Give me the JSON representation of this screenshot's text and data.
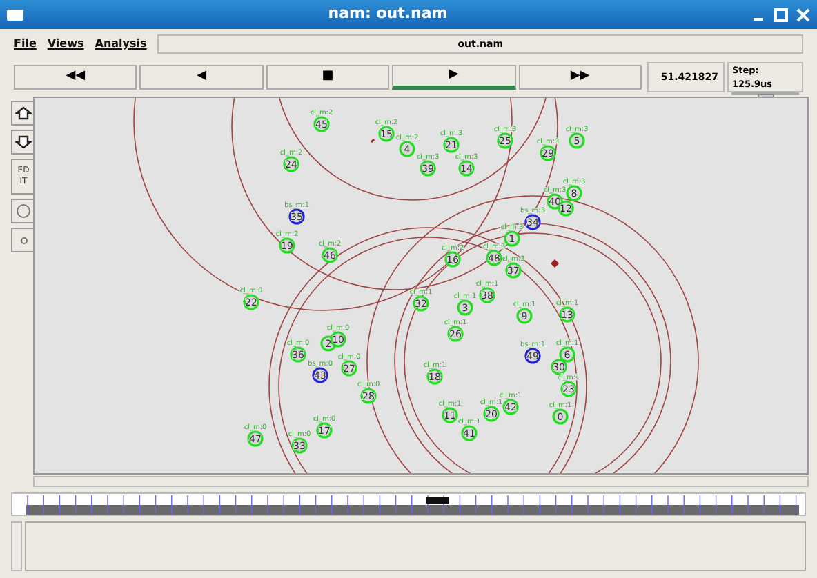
{
  "window": {
    "title": "nam: out.nam"
  },
  "menu": [
    {
      "label": "File"
    },
    {
      "label": "Views"
    },
    {
      "label": "Analysis"
    }
  ],
  "file_field": {
    "value": "out.nam"
  },
  "transport": [
    {
      "glyph": "◀◀",
      "selected": false
    },
    {
      "glyph": "◀",
      "selected": false
    },
    {
      "glyph": "■",
      "selected": false
    },
    {
      "glyph": "▶",
      "selected": true
    },
    {
      "glyph": "▶▶",
      "selected": false
    }
  ],
  "time": "51.421827",
  "step": {
    "label": "Step: 125.9us",
    "level": 0.5
  },
  "tools": [
    {
      "kind": "zoom-in"
    },
    {
      "kind": "zoom-out"
    },
    {
      "kind": "edit",
      "label": "EDIT"
    },
    {
      "kind": "circle"
    },
    {
      "kind": "dot"
    }
  ],
  "nodes": [
    {
      "id": "45",
      "label": "cl_m:2",
      "kind": "mobile"
    },
    {
      "id": "15",
      "label": "cl_m:2",
      "kind": "mobile"
    },
    {
      "id": "4",
      "label": "cl_m:2",
      "kind": "mobile"
    },
    {
      "id": "21",
      "label": "cl_m:3",
      "kind": "mobile"
    },
    {
      "id": "25",
      "label": "cl_m:3",
      "kind": "mobile"
    },
    {
      "id": "29",
      "label": "cl_m:3",
      "kind": "mobile"
    },
    {
      "id": "5",
      "label": "cl_m:3",
      "kind": "mobile"
    },
    {
      "id": "24",
      "label": "cl_m:2",
      "kind": "mobile"
    },
    {
      "id": "39",
      "label": "cl_m:3",
      "kind": "mobile"
    },
    {
      "id": "14",
      "label": "cl_m:3",
      "kind": "mobile"
    },
    {
      "id": "8",
      "label": "cl_m:3",
      "kind": "mobile"
    },
    {
      "id": "40",
      "label": "cl_m:3",
      "kind": "mobile"
    },
    {
      "id": "35",
      "label": "bs_m:1",
      "kind": "base"
    },
    {
      "id": "34",
      "label": "bs_m:3",
      "kind": "base"
    },
    {
      "id": "12",
      "kind": "mobile"
    },
    {
      "id": "1",
      "label": "cl_m:3",
      "kind": "mobile"
    },
    {
      "id": "19",
      "label": "cl_m:2",
      "kind": "mobile"
    },
    {
      "id": "46",
      "label": "cl_m:2",
      "kind": "mobile"
    },
    {
      "id": "16",
      "label": "cl_m:2",
      "kind": "mobile"
    },
    {
      "id": "48",
      "label": "cl_m:3",
      "kind": "mobile"
    },
    {
      "id": "37",
      "label": "cl_m:3",
      "kind": "mobile"
    },
    {
      "id": "22",
      "label": "cl_m:0",
      "kind": "mobile"
    },
    {
      "id": "32",
      "label": "cl_m:1",
      "kind": "mobile"
    },
    {
      "id": "3",
      "label": "cl_m:1",
      "kind": "mobile"
    },
    {
      "id": "38",
      "label": "cl_m:1",
      "kind": "mobile"
    },
    {
      "id": "9",
      "label": "cl_m:1",
      "kind": "mobile"
    },
    {
      "id": "13",
      "label": "cl_m:1",
      "kind": "mobile"
    },
    {
      "id": "26",
      "label": "cl_m:1",
      "kind": "mobile"
    },
    {
      "id": "2",
      "kind": "mobile"
    },
    {
      "id": "10",
      "label": "cl_m:0",
      "kind": "mobile"
    },
    {
      "id": "36",
      "label": "cl_m:0",
      "kind": "mobile"
    },
    {
      "id": "43",
      "label": "bs_m:0",
      "kind": "base"
    },
    {
      "id": "27",
      "label": "cl_m:0",
      "kind": "mobile"
    },
    {
      "id": "18",
      "label": "cl_m:1",
      "kind": "mobile"
    },
    {
      "id": "49",
      "label": "bs_m:1",
      "kind": "base"
    },
    {
      "id": "6",
      "label": "cl_m:1",
      "kind": "mobile"
    },
    {
      "id": "30",
      "kind": "mobile"
    },
    {
      "id": "28",
      "label": "cl_m:0",
      "kind": "mobile"
    },
    {
      "id": "23",
      "label": "cl_m:1",
      "kind": "mobile"
    },
    {
      "id": "11",
      "label": "cl_m:1",
      "kind": "mobile"
    },
    {
      "id": "20",
      "label": "cl_m:1",
      "kind": "mobile"
    },
    {
      "id": "42",
      "label": "cl_m:1",
      "kind": "mobile"
    },
    {
      "id": "0",
      "label": "cl_m:1",
      "kind": "mobile"
    },
    {
      "id": "47",
      "label": "cl_m:0",
      "kind": "mobile"
    },
    {
      "id": "33",
      "label": "cl_m:0",
      "kind": "mobile"
    },
    {
      "id": "17",
      "label": "cl_m:0",
      "kind": "mobile"
    },
    {
      "id": "41",
      "label": "cl_m:1",
      "kind": "mobile"
    }
  ]
}
